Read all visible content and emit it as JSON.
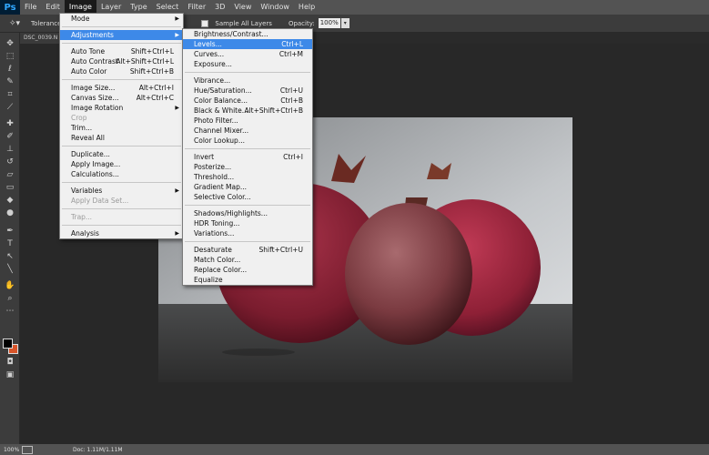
{
  "menubar": {
    "logo": "Ps",
    "items": [
      "File",
      "Edit",
      "Image",
      "Layer",
      "Type",
      "Select",
      "Filter",
      "3D",
      "View",
      "Window",
      "Help"
    ]
  },
  "options": {
    "tolerance_label": "Tolerance",
    "sample_label": "Sample All Layers",
    "opacity_label": "Opacity:",
    "opacity_value": "100%"
  },
  "doc": {
    "tab_title": "DSC_0039.N"
  },
  "status": {
    "zoom": "100%",
    "doc_info": "Doc: 1.11M/1.11M"
  },
  "image_menu": {
    "mode": "Mode",
    "adjustments": "Adjustments",
    "auto_tone": "Auto Tone",
    "auto_tone_sc": "Shift+Ctrl+L",
    "auto_contrast": "Auto Contrast",
    "auto_contrast_sc": "Alt+Shift+Ctrl+L",
    "auto_color": "Auto Color",
    "auto_color_sc": "Shift+Ctrl+B",
    "image_size": "Image Size...",
    "image_size_sc": "Alt+Ctrl+I",
    "canvas_size": "Canvas Size...",
    "canvas_size_sc": "Alt+Ctrl+C",
    "image_rotation": "Image Rotation",
    "crop": "Crop",
    "trim": "Trim...",
    "reveal_all": "Reveal All",
    "duplicate": "Duplicate...",
    "apply_image": "Apply Image...",
    "calculations": "Calculations...",
    "variables": "Variables",
    "apply_data_set": "Apply Data Set...",
    "trap": "Trap...",
    "analysis": "Analysis"
  },
  "adjust_menu": {
    "brightness": "Brightness/Contrast...",
    "levels": "Levels...",
    "levels_sc": "Ctrl+L",
    "curves": "Curves...",
    "curves_sc": "Ctrl+M",
    "exposure": "Exposure...",
    "vibrance": "Vibrance...",
    "hue_sat": "Hue/Saturation...",
    "hue_sat_sc": "Ctrl+U",
    "color_balance": "Color Balance...",
    "color_balance_sc": "Ctrl+B",
    "bw": "Black & White...",
    "bw_sc": "Alt+Shift+Ctrl+B",
    "photo_filter": "Photo Filter...",
    "channel_mixer": "Channel Mixer...",
    "color_lookup": "Color Lookup...",
    "invert": "Invert",
    "invert_sc": "Ctrl+I",
    "posterize": "Posterize...",
    "threshold": "Threshold...",
    "gradient_map": "Gradient Map...",
    "selective_color": "Selective Color...",
    "shadows": "Shadows/Highlights...",
    "hdr": "HDR Toning...",
    "variations": "Variations...",
    "desaturate": "Desaturate",
    "desaturate_sc": "Shift+Ctrl+U",
    "match_color": "Match Color...",
    "replace_color": "Replace Color...",
    "equalize": "Equalize"
  }
}
